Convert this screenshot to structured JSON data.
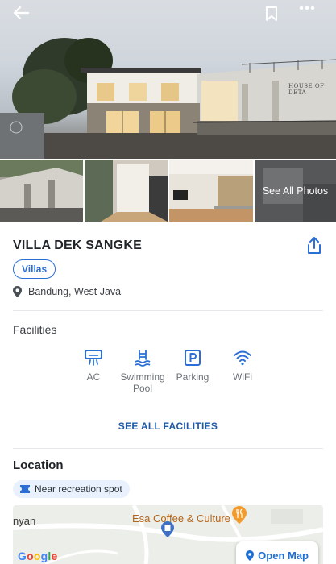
{
  "property": {
    "name": "VILLA DEK SANGKE",
    "category": "Villas",
    "location": "Bandung, West Java",
    "signage": "HOUSE OF DETA"
  },
  "gallery": {
    "see_all_label": "See All Photos"
  },
  "facilities": {
    "heading": "Facilities",
    "items": [
      {
        "icon": "ac-icon",
        "label": "AC"
      },
      {
        "icon": "swimming-pool-icon",
        "label": "Swimming Pool"
      },
      {
        "icon": "parking-icon",
        "label": "Parking"
      },
      {
        "icon": "wifi-icon",
        "label": "WiFi"
      }
    ],
    "see_all_label": "SEE ALL FACILITIES"
  },
  "location_section": {
    "heading": "Location",
    "tag": "Near recreation spot",
    "map": {
      "place_label": "Esa Coffee & Culture",
      "partial_label": "nyan",
      "provider": "Google",
      "open_map_label": "Open Map"
    }
  },
  "colors": {
    "accent": "#2b6fd6",
    "accent_dark": "#1e5aa8",
    "chip_bg": "#e8f1fd"
  }
}
